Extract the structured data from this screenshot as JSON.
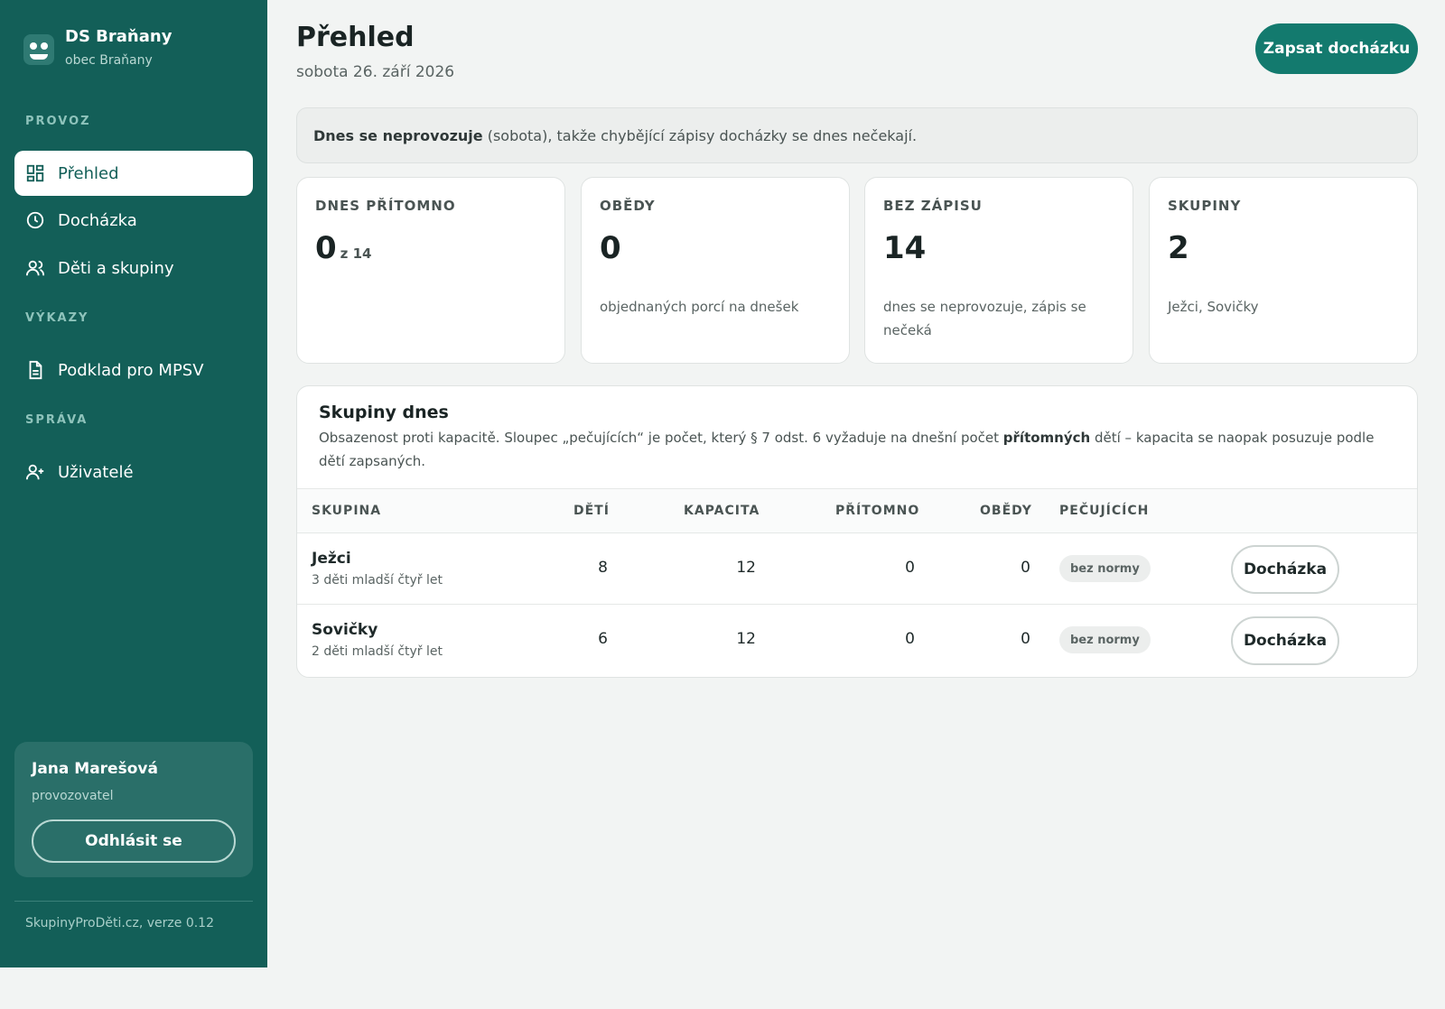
{
  "app": {
    "name": "DS Braňany",
    "subtitle": "obec Braňany",
    "version": "SkupinyProDěti.cz, verze 0.12"
  },
  "sidebar": {
    "sections": {
      "provoz": "PROVOZ",
      "vykazy": "VÝKAZY",
      "sprava": "SPRÁVA"
    },
    "items": [
      {
        "label": "Přehled",
        "icon": "dashboard-icon",
        "active": true
      },
      {
        "label": "Docházka",
        "icon": "clock-icon"
      },
      {
        "label": "Děti a skupiny",
        "icon": "users-icon"
      },
      {
        "label": "Podklad pro MPSV",
        "icon": "document-icon"
      },
      {
        "label": "Uživatelé",
        "icon": "user-plus-icon"
      }
    ]
  },
  "user": {
    "name": "Jana Marešová",
    "role": "provozovatel",
    "logout_label": "Odhlásit se"
  },
  "header": {
    "title": "Přehled",
    "date": "sobota 26. září 2026",
    "primary_action": "Zapsat docházku"
  },
  "notice": {
    "bold": "Dnes se neprovozuje",
    "rest": " (sobota), takže chybějící zápisy docházky se dnes nečekají."
  },
  "stats": [
    {
      "label": "DNES PŘÍTOMNO",
      "value": "0",
      "of": "z 14",
      "note": ""
    },
    {
      "label": "OBĚDY",
      "value": "0",
      "note": "objednaných porcí na dnešek"
    },
    {
      "label": "BEZ ZÁPISU",
      "value": "14",
      "note": "dnes se neprovozuje, zápis se nečeká"
    },
    {
      "label": "SKUPINY",
      "value": "2",
      "note": "Ježci, Sovičky"
    }
  ],
  "groups": {
    "title": "Skupiny dnes",
    "desc_part1": "Obsazenost proti kapacitě. Sloupec „pečujících“ je počet, který § 7 odst. 6 vyžaduje na dnešní počet ",
    "desc_bold": "přítomných",
    "desc_part2": " dětí – kapacita se naopak posuzuje podle dětí zapsaných.",
    "columns": [
      "SKUPINA",
      "DĚTÍ",
      "KAPACITA",
      "PŘÍTOMNO",
      "OBĚDY",
      "PEČUJÍCÍCH"
    ],
    "rows": [
      {
        "name": "Ježci",
        "sub": "3 děti mladší čtyř let",
        "children": "8",
        "capacity": "12",
        "present": "0",
        "lunches": "0",
        "carers": "bez normy",
        "action": "Docházka"
      },
      {
        "name": "Sovičky",
        "sub": "2 děti mladší čtyř let",
        "children": "6",
        "capacity": "12",
        "present": "0",
        "lunches": "0",
        "carers": "bez normy",
        "action": "Docházka"
      }
    ]
  },
  "colors": {
    "sidebar": "#135f58",
    "accent": "#137a6e",
    "background": "#f2f4f3"
  }
}
